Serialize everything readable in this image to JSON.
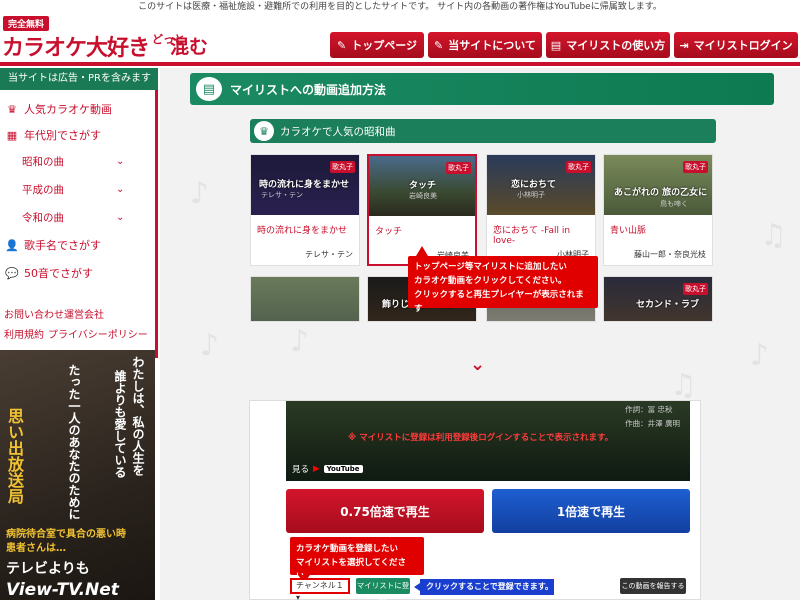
{
  "notice": "このサイトは医療・福祉施設・避難所での利用を目的としたサイトです。 サイト内の各動画の著作権はYouTubeに帰属致します。",
  "logo": {
    "tag": "完全無料",
    "main": "カラオケ大好き",
    "sub": "どっと",
    "big": "混む"
  },
  "nav": [
    {
      "label": "トップページ",
      "icon": "pen-icon"
    },
    {
      "label": "当サイトについて",
      "icon": "pen-icon"
    },
    {
      "label": "マイリストの使い方",
      "icon": "book-icon"
    },
    {
      "label": "マイリストログイン",
      "icon": "login-icon"
    }
  ],
  "sidebar": {
    "ad": "当サイトは広告・PRを含みます",
    "items": [
      {
        "label": "人気カラオケ動画",
        "icon": "crown-icon"
      },
      {
        "label": "年代別でさがす",
        "icon": "calendar-icon"
      },
      {
        "label": "昭和の曲"
      },
      {
        "label": "平成の曲"
      },
      {
        "label": "令和の曲"
      },
      {
        "label": "歌手名でさがす",
        "icon": "person-icon"
      },
      {
        "label": "50音でさがす",
        "icon": "speech-icon"
      }
    ],
    "links": [
      "お問い合わせ",
      "運営会社",
      "利用規約",
      "プライバシーポリシー"
    ],
    "poster": {
      "v1": "わたしは、私の人生を",
      "v2": "誰よりも愛している",
      "v3": "たった一人のあなたのために",
      "yellow": "思い出放送局",
      "bottom1": "病院待合室で具合の悪い時",
      "bottom2": "患者さんは…",
      "tv": "テレビよりも",
      "vtv": "View-TV.Net"
    }
  },
  "banner": "マイリストへの動画追加方法",
  "subbanner": "カラオケで人気の昭和曲",
  "cards": [
    {
      "title": "時の流れに身をまかせ",
      "artist": "テレサ・テン",
      "lyric": "時の流れに身をまかせ",
      "lyric2": "テレサ・テン"
    },
    {
      "title": "タッチ",
      "artist": "岩崎良美",
      "lyric": "タッチ",
      "lyric2": "岩崎良美"
    },
    {
      "title": "恋におちて -Fall in love-",
      "artist": "小林明子",
      "lyric": "恋におちて",
      "lyric2": "小林明子"
    },
    {
      "title": "青い山脈",
      "artist": "藤山一郎・奈良光枝",
      "lyric": "あこがれの 旅の乙女に",
      "lyric2": "鳥も啼く"
    }
  ],
  "cards2": [
    {
      "lyric": ""
    },
    {
      "lyric": "飾りじゃないのよ"
    },
    {
      "lyric": ""
    },
    {
      "lyric": "セカンド・ラブ"
    }
  ],
  "badge": "歌丸子",
  "tooltip1": [
    "トップページ等マイリストに追加したい",
    "カラオケ動画をクリックしてください。",
    "クリックすると再生プレイヤーが表示されます"
  ],
  "video": {
    "credit1": "作詞：冨 忠秋",
    "credit2": "作曲：井澤 廣明",
    "warn": "※ マイリストに登録は利用登録後ログインすることで表示されます。",
    "watch": "見る",
    "yt": "YouTube"
  },
  "speed": {
    "slow": "0.75倍速で再生",
    "normal": "1倍速で再生"
  },
  "tooltip2": [
    "カラオケ動画を登録したい",
    "マイリストを選択してください。"
  ],
  "channel": "チャンネル１ ▾",
  "register": "マイリストに登録",
  "tooltip3": "クリックすることで登録できます。",
  "report": "この動画を報告する"
}
